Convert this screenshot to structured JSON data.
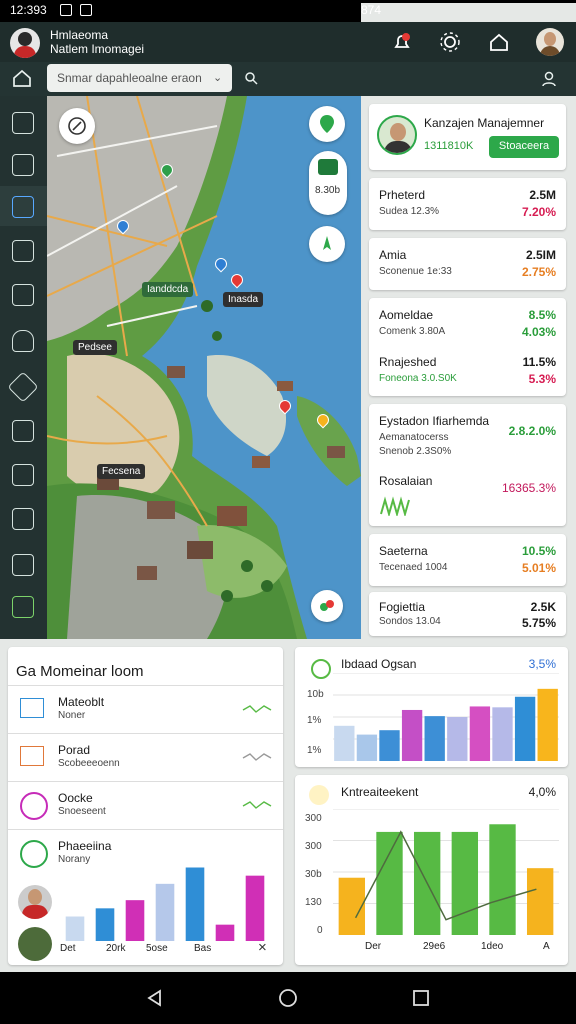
{
  "status": {
    "time": "12:393",
    "right": "874"
  },
  "appbar": {
    "title_line1": "Hmlaeoma",
    "title_line2": "Natlem Imomagei"
  },
  "search": {
    "value": "Snmar dapahleoalne eraon"
  },
  "rail": {
    "icons": [
      "house-icon",
      "compass-icon",
      "monitor-icon",
      "document-icon",
      "briefcase-icon",
      "gear-icon",
      "cloud-icon",
      "tag-icon",
      "search-icon",
      "calendar-icon",
      "activity-icon",
      "list-icon",
      "frame-icon"
    ]
  },
  "map": {
    "labels": [
      "Inasda",
      "Ianddcda",
      "Pedsee",
      "Fecsena"
    ],
    "fab_value": "8.30b"
  },
  "right_panel": {
    "profile": {
      "name": "Kanzajen Manajemner",
      "value": "1311810K",
      "button": "Stoaceera"
    },
    "items": [
      {
        "title": "Prheterd",
        "sub": "Sudea 12.3%",
        "value1": "2.5M",
        "value2": "7.20%",
        "c1": "#1a1a1a",
        "c2": "#d61c52"
      },
      {
        "title": "Amia",
        "sub": "Sconenue 1e:33",
        "value1": "2.5IM",
        "value2": "2.75%",
        "c1": "#1a1a1a",
        "c2": "#e67e22"
      },
      {
        "title": "Aomeldae",
        "sub": "Comenk 3.80A",
        "value1": "8.5%",
        "value2": "4.03%",
        "c1": "#2a9d3a",
        "c2": "#2a9d3a"
      },
      {
        "title": "Rnajeshed",
        "sub": "Foneona 3.0.S0K",
        "value1": "11.5%",
        "value2": "5.3%",
        "c1": "#1a1a1a",
        "c2": "#d61c52"
      },
      {
        "title": "Eystadon Ifiarhemda",
        "sub": "Aemanatocerss",
        "sub2": "Snenob 2.3S0%",
        "value1": "2.8.2.0%",
        "value2": "",
        "c1": "#2a9d3a",
        "c2": "#2a9d3a"
      },
      {
        "title": "Rosalaian",
        "sub": "",
        "value1": "16365.3%",
        "value2": "",
        "c1": "#c2185b",
        "c2": "#c2185b"
      },
      {
        "title": "Saeterna",
        "sub": "Tecenaed 1004",
        "value1": "10.5%",
        "value2": "5.01%",
        "c1": "#2a9d3a",
        "c2": "#e67e22"
      },
      {
        "title": "Fogiettia",
        "sub": "Sondos 13.04",
        "value1": "2.5K",
        "value2": "5.75%",
        "c1": "#1a1a1a",
        "c2": "#1a1a1a"
      }
    ]
  },
  "list_panel": {
    "header": "Ga Momeinar loom",
    "rows": [
      {
        "title": "Mateoblt",
        "sub": "Noner"
      },
      {
        "title": "Porad",
        "sub": "Scobeeeoenn"
      },
      {
        "title": "Oocke",
        "sub": "Snoeseent"
      },
      {
        "title": "Phaeeiina",
        "sub": "Norany"
      }
    ]
  },
  "mini_chart": {
    "labels": [
      "Det",
      "20rk",
      "5ose",
      "Bas"
    ],
    "close": "×"
  },
  "chart_data": [
    {
      "type": "bar",
      "title": "",
      "categories": [
        "1",
        "2",
        "3",
        "4",
        "5",
        "6",
        "7"
      ],
      "series": [
        {
          "name": "",
          "values": [
            15,
            20,
            25,
            35,
            45,
            10,
            40
          ]
        }
      ],
      "ylim": [
        0,
        60
      ]
    },
    {
      "type": "bar",
      "title": "Ibdaad Ogsan",
      "value_label": "3,5%",
      "yticks": [
        "10b",
        "1%",
        "1%"
      ],
      "categories": [
        "1",
        "2",
        "3",
        "4",
        "5",
        "6",
        "7",
        "8",
        "9",
        "10"
      ],
      "series": [
        {
          "name": "",
          "values": [
            4.0,
            3.0,
            3.5,
            5.8,
            5.1,
            5.0,
            6.2,
            6.1,
            7.3,
            8.2
          ]
        }
      ],
      "colors": [
        "#c8d9ef",
        "#a9c7ea",
        "#3d8fd6",
        "#c44fc6",
        "#3d8fd6",
        "#b5b9e8",
        "#d54fc2",
        "#b5b9e8",
        "#2f8ed6",
        "#f8b51c"
      ],
      "ylim": [
        0,
        10
      ]
    },
    {
      "type": "bar",
      "title": "Kntreaiteekent",
      "value_label": "4,0%",
      "yticks": [
        "300",
        "300",
        "30b",
        "130",
        "0"
      ],
      "xticks": [
        "Der",
        "29e6",
        "1deo",
        "A"
      ],
      "categories": [
        "1",
        "2",
        "3",
        "4",
        "5",
        "6"
      ],
      "series": [
        {
          "name": "",
          "values": [
            150,
            270,
            270,
            270,
            290,
            175
          ]
        }
      ],
      "line": [
        45,
        270,
        40,
        85,
        120
      ],
      "colors": [
        "#f5b31e",
        "#57ba44",
        "#57ba44",
        "#57ba44",
        "#57ba44",
        "#f5b31e"
      ],
      "ylim": [
        0,
        330
      ]
    }
  ]
}
